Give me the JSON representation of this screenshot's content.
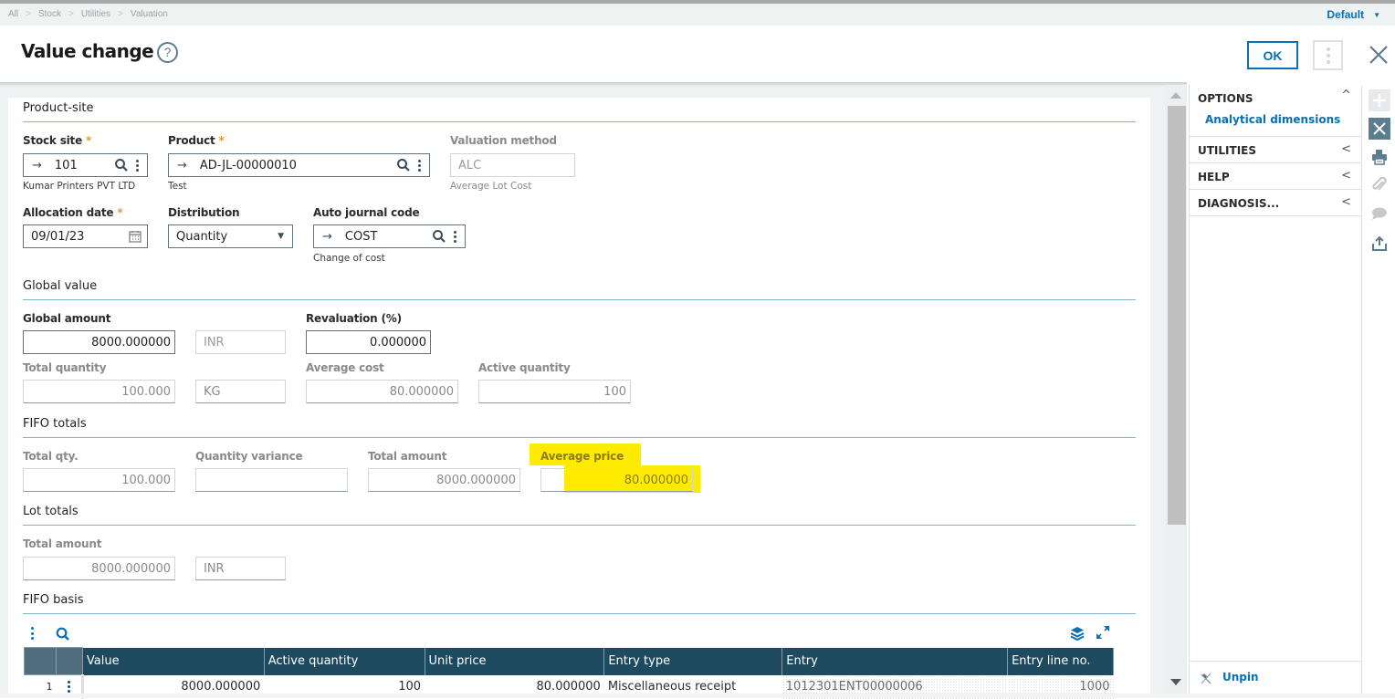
{
  "breadcrumb": [
    "All",
    "Stock",
    "Utilities",
    "Valuation"
  ],
  "view_selector": "Default",
  "header": {
    "title": "Value change",
    "ok_label": "OK"
  },
  "sections": {
    "product_site": "Product-site",
    "global_value": "Global value",
    "fifo_totals": "FIFO totals",
    "lot_totals": "Lot totals",
    "fifo_basis": "FIFO basis"
  },
  "product_site": {
    "stock_site": {
      "label": "Stock site",
      "value": "101",
      "description": "Kumar Printers PVT LTD"
    },
    "product": {
      "label": "Product",
      "value": "AD-JL-00000010",
      "description": "Test"
    },
    "valuation_method": {
      "label": "Valuation method",
      "value": "ALC",
      "description": "Average Lot Cost"
    },
    "allocation_date": {
      "label": "Allocation date",
      "value": "09/01/23"
    },
    "distribution": {
      "label": "Distribution",
      "value": "Quantity"
    },
    "auto_journal_code": {
      "label": "Auto journal code",
      "value": "COST",
      "description": "Change of cost"
    }
  },
  "global_value": {
    "global_amount": {
      "label": "Global amount",
      "value": "8000.000000",
      "currency": "INR"
    },
    "revaluation": {
      "label": "Revaluation (%)",
      "value": "0.000000"
    },
    "total_quantity": {
      "label": "Total quantity",
      "value": "100.000",
      "unit": "KG"
    },
    "average_cost": {
      "label": "Average cost",
      "value": "80.000000"
    },
    "active_quantity": {
      "label": "Active quantity",
      "value": "100"
    }
  },
  "fifo_totals": {
    "total_qty": {
      "label": "Total qty.",
      "value": "100.000"
    },
    "quantity_variance": {
      "label": "Quantity variance",
      "value": ""
    },
    "total_amount": {
      "label": "Total amount",
      "value": "8000.000000"
    },
    "average_price": {
      "label": "Average price",
      "value": "80.000000"
    }
  },
  "lot_totals": {
    "total_amount": {
      "label": "Total amount",
      "value": "8000.000000",
      "currency": "INR"
    }
  },
  "fifo_basis": {
    "columns": [
      "Value",
      "Active quantity",
      "Unit price",
      "Entry type",
      "Entry",
      "Entry line no."
    ],
    "rows": [
      {
        "num": "1",
        "value": "8000.000000",
        "active_quantity": "100",
        "unit_price": "80.000000",
        "entry_type": "Miscellaneous receipt",
        "entry": "1012301ENT00000006",
        "entry_line_no": "1000"
      }
    ]
  },
  "side_panel": {
    "options": "OPTIONS",
    "analytical_dimensions": "Analytical dimensions",
    "utilities": "UTILITIES",
    "help": "HELP",
    "diagnosis": "DIAGNOSIS...",
    "unpin": "Unpin"
  },
  "colors": {
    "accent": "#0b6fb3",
    "grid_header": "#1e4a5f",
    "highlight": "#ffeb00",
    "required_star": "#e39b2b"
  }
}
